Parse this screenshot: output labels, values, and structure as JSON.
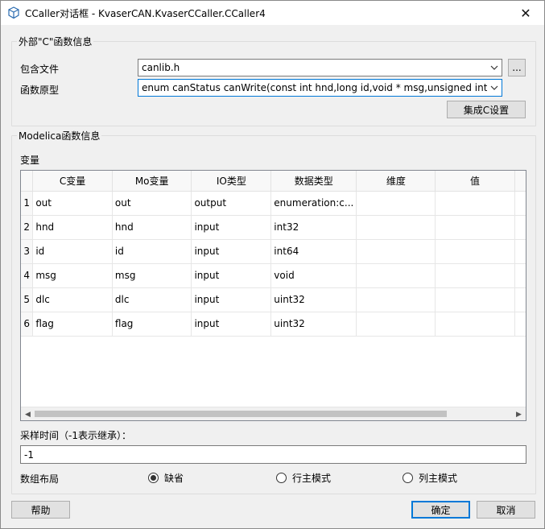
{
  "window": {
    "title": "CCaller对话框 - KvaserCAN.KvaserCCaller.CCaller4",
    "close_glyph": "✕"
  },
  "external": {
    "group_title": "外部\"C\"函数信息",
    "include_label": "包含文件",
    "include_value": "canlib.h",
    "browse_label": "...",
    "prototype_label": "函数原型",
    "prototype_value": "enum canStatus  canWrite(const int hnd,long id,void * msg,unsigned int dlc,unsigned int flag)",
    "integrate_button": "集成C设置"
  },
  "modelica": {
    "group_title": "Modelica函数信息",
    "variables_label": "变量",
    "columns": [
      "C变量",
      "Mo变量",
      "IO类型",
      "数据类型",
      "维度",
      "值"
    ],
    "rows": [
      {
        "n": "1",
        "c": "out",
        "mo": "out",
        "io": "output",
        "type": "enumeration:c...",
        "dim": "",
        "val": ""
      },
      {
        "n": "2",
        "c": "hnd",
        "mo": "hnd",
        "io": "input",
        "type": "int32",
        "dim": "",
        "val": ""
      },
      {
        "n": "3",
        "c": "id",
        "mo": "id",
        "io": "input",
        "type": "int64",
        "dim": "",
        "val": ""
      },
      {
        "n": "4",
        "c": "msg",
        "mo": "msg",
        "io": "input",
        "type": "void",
        "dim": "",
        "val": ""
      },
      {
        "n": "5",
        "c": "dlc",
        "mo": "dlc",
        "io": "input",
        "type": "uint32",
        "dim": "",
        "val": ""
      },
      {
        "n": "6",
        "c": "flag",
        "mo": "flag",
        "io": "input",
        "type": "uint32",
        "dim": "",
        "val": ""
      }
    ],
    "sample_label": "采样时间（-1表示继承）：",
    "sample_value": "-1",
    "layout_label": "数组布局",
    "layout_options": [
      {
        "label": "缺省",
        "checked": true
      },
      {
        "label": "行主模式",
        "checked": false
      },
      {
        "label": "列主模式",
        "checked": false
      }
    ]
  },
  "footer": {
    "help": "帮助",
    "ok": "确定",
    "cancel": "取消"
  }
}
